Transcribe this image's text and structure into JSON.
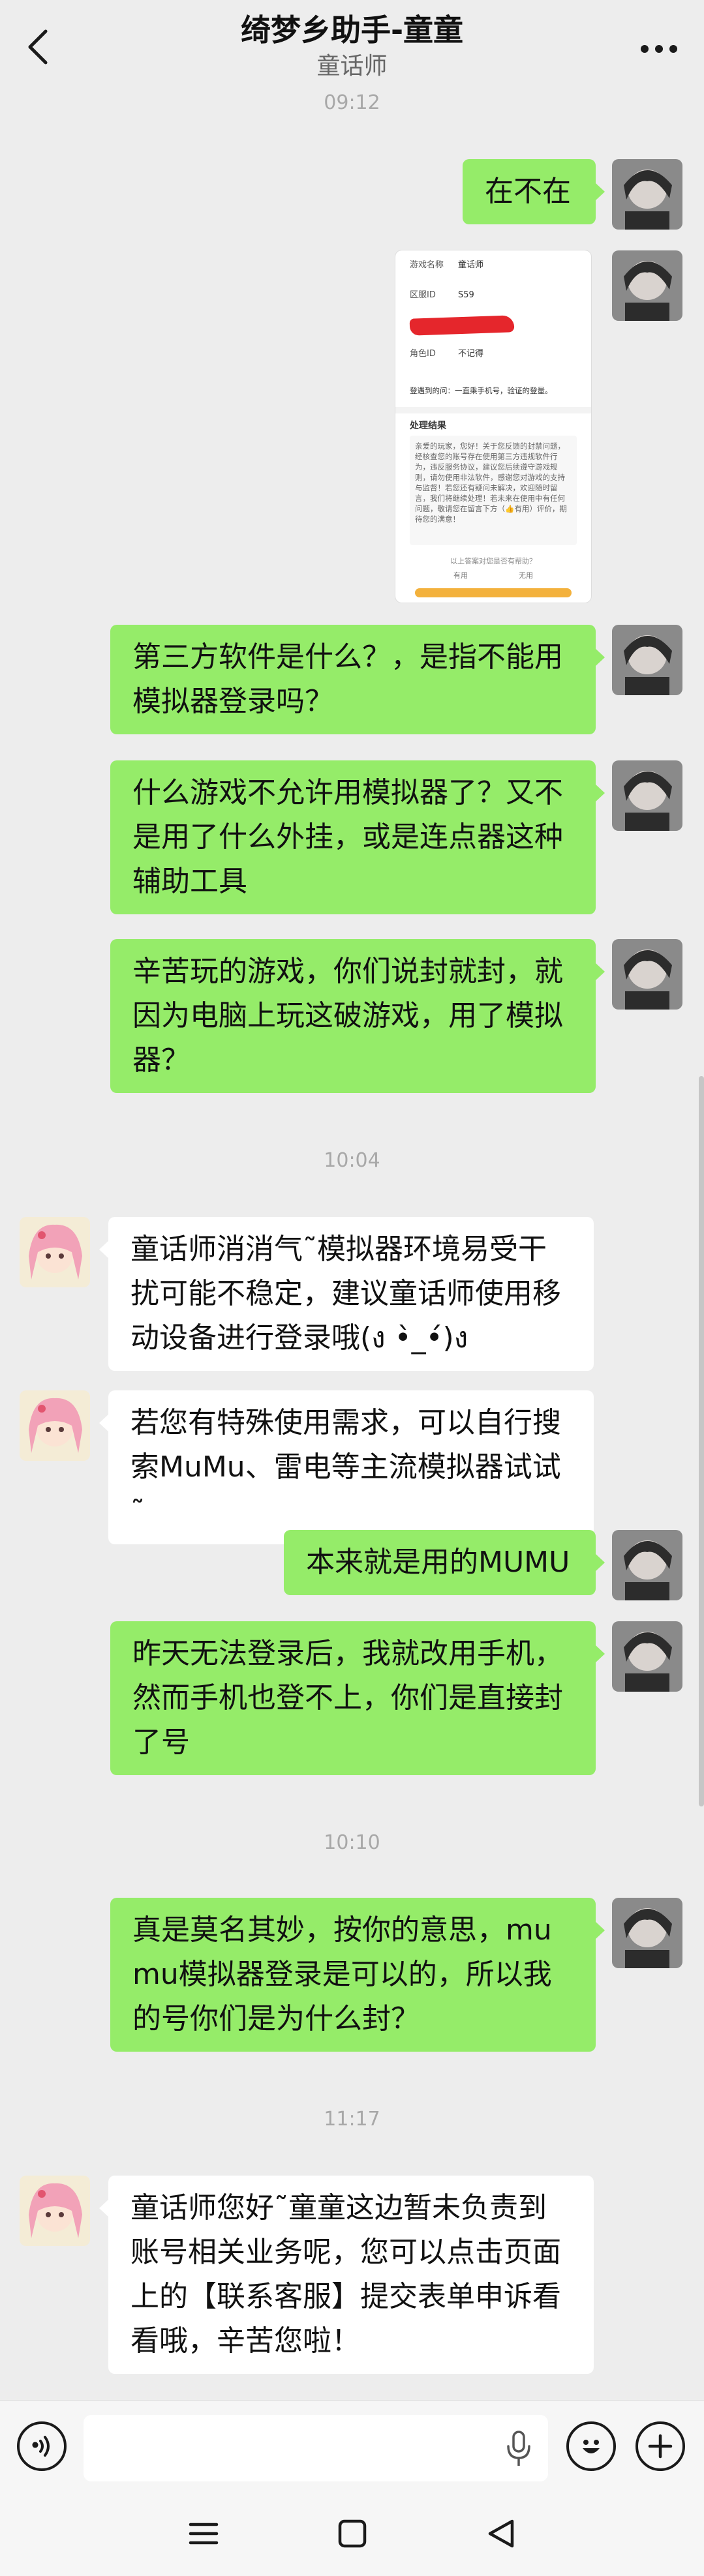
{
  "header": {
    "title": "绮梦乡助手-童童",
    "subtitle": "童话师"
  },
  "timestamps": [
    "09:12",
    "10:04",
    "10:10",
    "11:17"
  ],
  "messages": [
    {
      "id": "m1",
      "side": "out",
      "text": "在不在"
    },
    {
      "id": "m2",
      "side": "out",
      "type": "image"
    },
    {
      "id": "m3",
      "side": "out",
      "text": "第三方软件是什么？，是指不能用模拟器登录吗？"
    },
    {
      "id": "m4",
      "side": "out",
      "text": "什么游戏不允许用模拟器了？又不是用了什么外挂，或是连点器这种辅助工具"
    },
    {
      "id": "m5",
      "side": "out",
      "text": "辛苦玩的游戏，你们说封就封，就因为电脑上玩这破游戏，用了模拟器？"
    },
    {
      "id": "m6",
      "side": "in",
      "text": "童话师消消气˜模拟器环境易受干扰可能不稳定，建议童话师使用移动设备进行登录哦(ง •̀_•́)ง"
    },
    {
      "id": "m7",
      "side": "in",
      "text": "若您有特殊使用需求，可以自行搜索MuMu、雷电等主流模拟器试试˜"
    },
    {
      "id": "m8",
      "side": "out",
      "text": "本来就是用的MUMU"
    },
    {
      "id": "m9",
      "side": "out",
      "text": "昨天无法登录后，我就改用手机，然而手机也登不上，你们是直接封了号"
    },
    {
      "id": "m10",
      "side": "out",
      "text": "真是莫名其妙，按你的意思，mumu模拟器登录是可以的，所以我的号你们是为什么封？"
    },
    {
      "id": "m11",
      "side": "in",
      "text": "童话师您好˜童童这边暂未负责到账号相关业务呢，您可以点击页面上的【联系客服】提交表单申诉看看哦，辛苦您啦！"
    }
  ],
  "screenshot": {
    "game_name_label": "游戏名称",
    "game_name_value": "童话师",
    "server_label": "区服ID",
    "server_value": "S59",
    "role_label": "角色ID",
    "role_value": "不记得",
    "problem_text": "登遇到的问：一直乘手机号，验证的登量。",
    "result_title": "处理结果",
    "result_text": "亲爱的玩家，您好！关于您反馈的封禁问题，经核查您的账号存在使用第三方违规软件行为，违反服务协议，建议您后续遵守游戏规则，请勿使用非法软件，感谢您对游戏的支持与监督！若您还有疑问未解决，欢迎随时留言，我们将继续处理！若未来在使用中有任何问题，敬请您在留言下方（👍有用）评价，期待您的满意！",
    "question": "以上答案对您是否有帮助？",
    "opt_yes": "有用",
    "opt_no": "无用"
  },
  "input": {
    "placeholder": ""
  },
  "icons": {
    "back": "chevron-left-icon",
    "more": "more-dots-icon",
    "voice": "voice-icon",
    "mic": "microphone-icon",
    "emoji": "emoji-icon",
    "plus": "plus-icon",
    "menu": "menu-icon",
    "home": "square-home-icon",
    "nav_back": "triangle-back-icon"
  },
  "colors": {
    "background": "#ededed",
    "outgoing_bubble": "#95ec69",
    "incoming_bubble": "#ffffff",
    "timestamp": "#a8a8a8"
  }
}
